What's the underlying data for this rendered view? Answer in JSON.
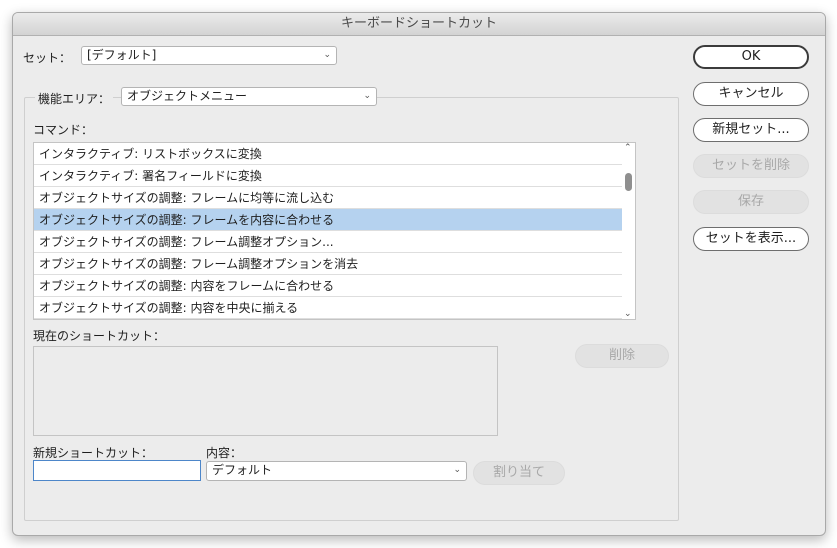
{
  "window": {
    "title": "キーボードショートカット"
  },
  "set": {
    "label": "セット：",
    "value": "[デフォルト]"
  },
  "function_area": {
    "label": "機能エリア：",
    "value": "オブジェクトメニュー"
  },
  "commands": {
    "label": "コマンド：",
    "items": [
      "インタラクティブ: リストボックスに変換",
      "インタラクティブ: 署名フィールドに変換",
      "オブジェクトサイズの調整: フレームに均等に流し込む",
      "オブジェクトサイズの調整: フレームを内容に合わせる",
      "オブジェクトサイズの調整: フレーム調整オプション...",
      "オブジェクトサイズの調整: フレーム調整オプションを消去",
      "オブジェクトサイズの調整: 内容をフレームに合わせる",
      "オブジェクトサイズの調整: 内容を中央に揃える"
    ],
    "selected_index": 3
  },
  "current_shortcut": {
    "label": "現在のショートカット：",
    "delete_button": "削除"
  },
  "new_shortcut": {
    "label": "新規ショートカット：",
    "value": ""
  },
  "context": {
    "label": "内容：",
    "value": "デフォルト"
  },
  "assign_button": "割り当て",
  "buttons": {
    "ok": "OK",
    "cancel": "キャンセル",
    "new_set": "新規セット...",
    "delete_set": "セットを削除",
    "save": "保存",
    "show_set": "セットを表示..."
  }
}
